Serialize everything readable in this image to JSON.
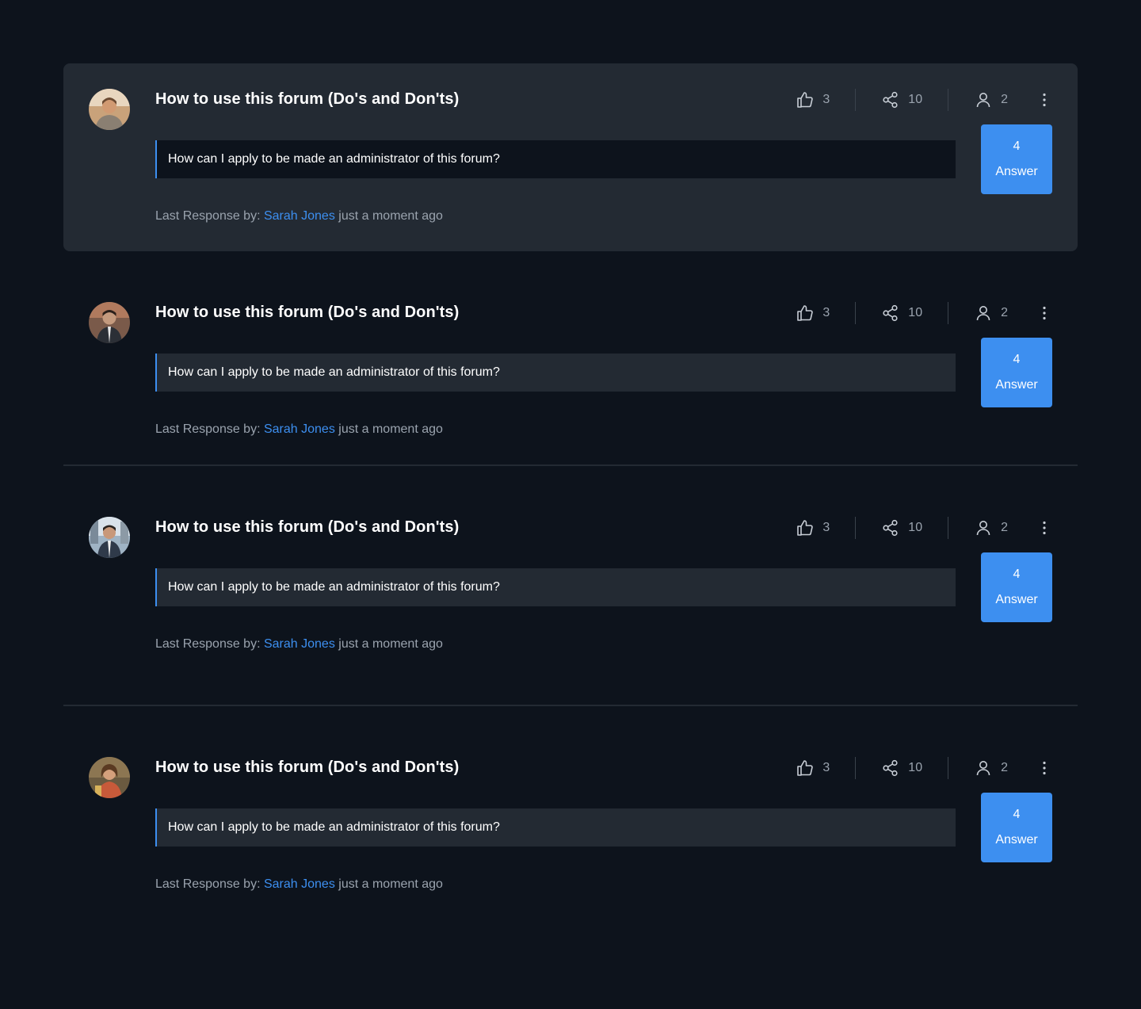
{
  "colors": {
    "background": "#0d131c",
    "card_highlight": "#232a33",
    "accent": "#3d8ff0",
    "muted_text": "#9aa3ae"
  },
  "posts": [
    {
      "title": "How to use this forum (Do's and Don'ts)",
      "likes": "3",
      "shares": "10",
      "participants": "2",
      "question": "How can I apply to be made an administrator of this forum?",
      "answer_count": "4",
      "answer_label": "Answer",
      "last_response_prefix": "Last Response by:",
      "last_response_user": "Sarah Jones",
      "last_response_time": "just a moment ago"
    },
    {
      "title": "How to use this forum (Do's and Don'ts)",
      "likes": "3",
      "shares": "10",
      "participants": "2",
      "question": "How can I apply to be made an administrator of this forum?",
      "answer_count": "4",
      "answer_label": "Answer",
      "last_response_prefix": "Last Response by:",
      "last_response_user": "Sarah Jones",
      "last_response_time": "just a moment ago"
    },
    {
      "title": "How to use this forum (Do's and Don'ts)",
      "likes": "3",
      "shares": "10",
      "participants": "2",
      "question": "How can I apply to be made an administrator of this forum?",
      "answer_count": "4",
      "answer_label": "Answer",
      "last_response_prefix": "Last Response by:",
      "last_response_user": "Sarah Jones",
      "last_response_time": "just a moment ago"
    },
    {
      "title": "How to use this forum (Do's and Don'ts)",
      "likes": "3",
      "shares": "10",
      "participants": "2",
      "question": "How can I apply to be made an administrator of this forum?",
      "answer_count": "4",
      "answer_label": "Answer",
      "last_response_prefix": "Last Response by:",
      "last_response_user": "Sarah Jones",
      "last_response_time": "just a moment ago"
    }
  ]
}
